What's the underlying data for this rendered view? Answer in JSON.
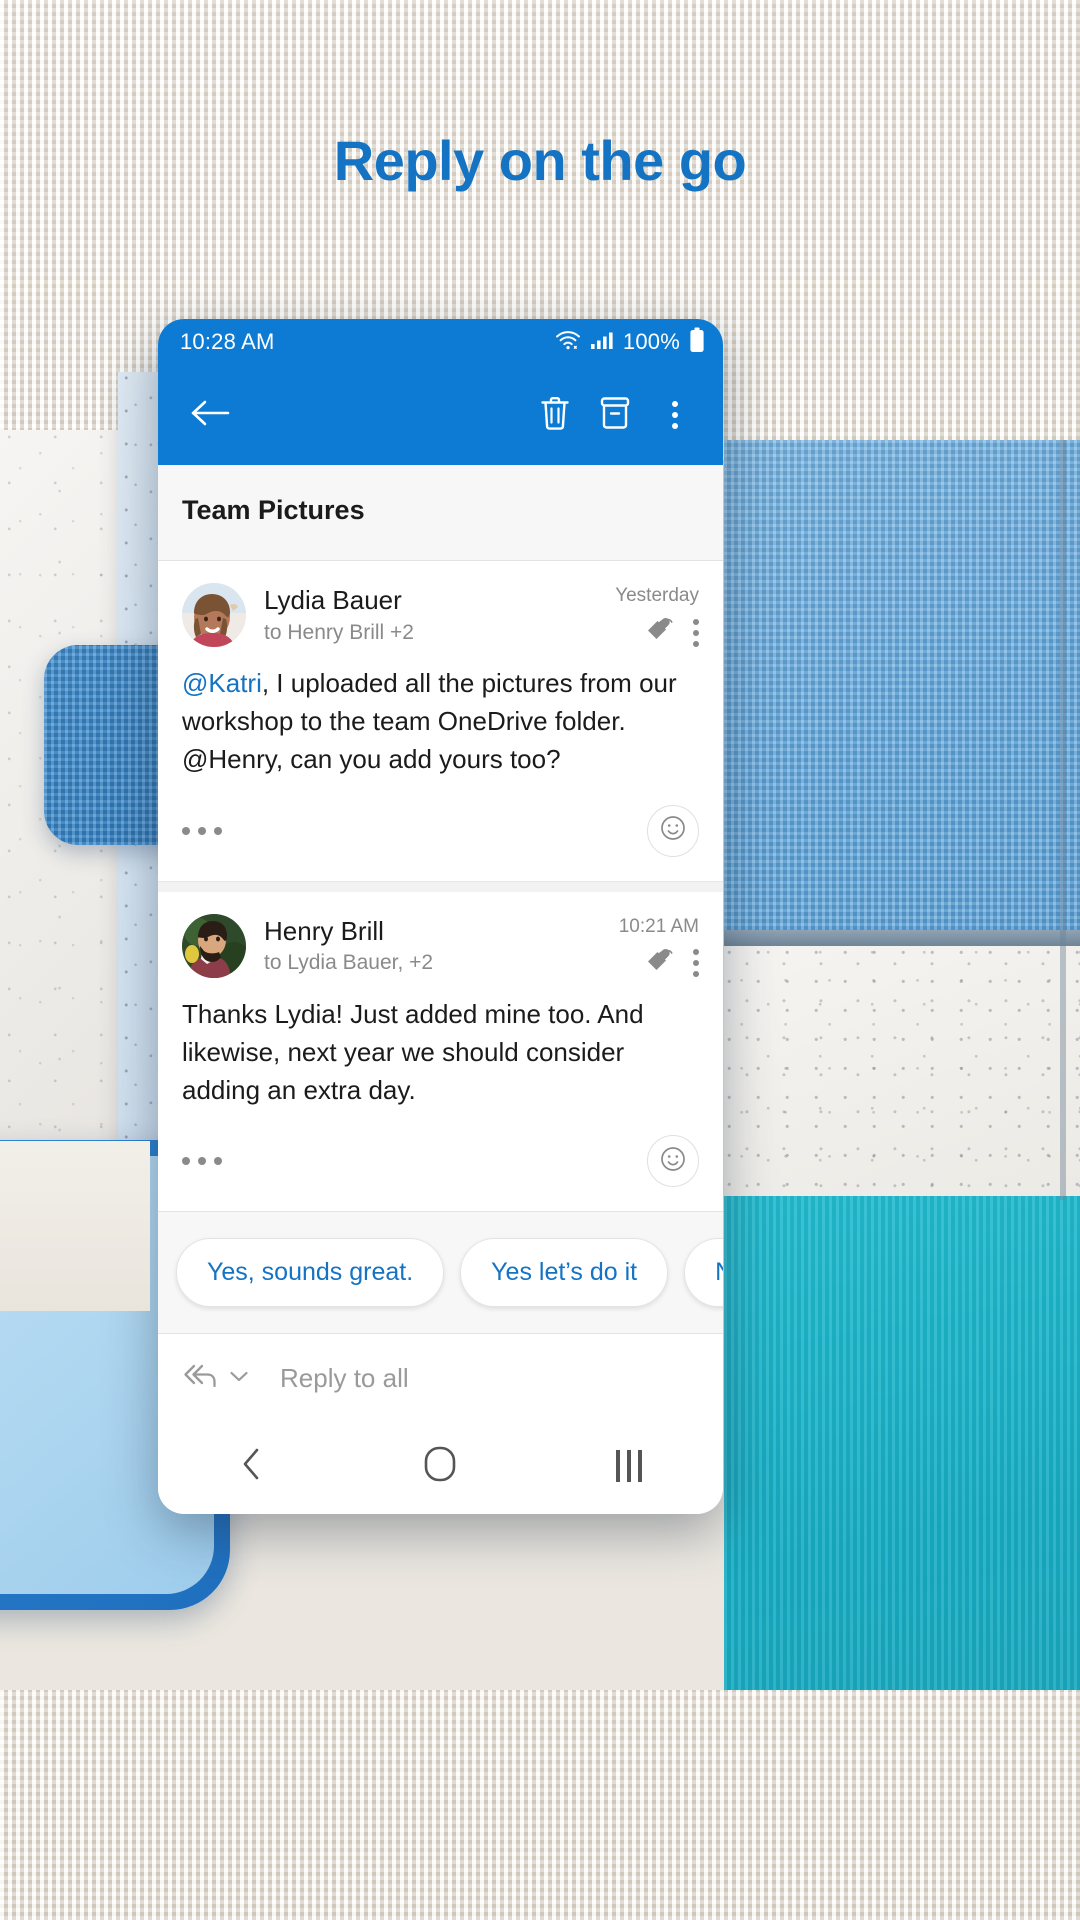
{
  "headline": "Reply on the go",
  "colors": {
    "brand_blue": "#0d7bd4",
    "link_blue": "#1573c4",
    "headline_blue": "#1573c4",
    "subject_bg": "#f7f7f7",
    "body_text": "#1b1b1b",
    "muted_text": "#8a8a8a"
  },
  "status_bar": {
    "time": "10:28 AM",
    "battery_percent": "100%",
    "icons": [
      "wifi-icon",
      "cellular-signal-icon",
      "battery-icon"
    ]
  },
  "app_bar": {
    "back": "back-arrow-icon",
    "delete": "trash-icon",
    "archive": "archive-icon",
    "overflow": "overflow-menu-icon"
  },
  "subject": "Team Pictures",
  "messages": [
    {
      "sender": "Lydia Bauer",
      "recipients": "to Henry Brill +2",
      "time": "Yesterday",
      "avatar": "avatar-lydia-bauer",
      "body_prefix": "@Katri",
      "body_rest": ", I uploaded all the pictures from our workshop to the team OneDrive folder. @Henry, can you add yours too?",
      "expand": "expand-ellipsis-icon",
      "reaction": "emoji-reaction-icon",
      "reply_action": "reply-icon",
      "overflow_action": "overflow-menu-icon"
    },
    {
      "sender": "Henry Brill",
      "recipients": "to Lydia Bauer, +2",
      "time": "10:21 AM",
      "avatar": "avatar-henry-brill",
      "body_prefix": "",
      "body_rest": "Thanks Lydia! Just added mine too. And likewise, next year we should consider adding an extra day.",
      "expand": "expand-ellipsis-icon",
      "reaction": "emoji-reaction-icon",
      "reply_action": "reply-icon",
      "overflow_action": "overflow-menu-icon"
    }
  ],
  "suggested_replies": [
    "Yes, sounds great.",
    "Yes let’s do it",
    "Not this"
  ],
  "reply_bar": {
    "icon": "reply-all-icon",
    "chevron": "chevron-down-icon",
    "placeholder": "Reply to all"
  },
  "nav_bar": {
    "back": "nav-back-icon",
    "home": "nav-home-icon",
    "recents": "nav-recents-icon"
  }
}
